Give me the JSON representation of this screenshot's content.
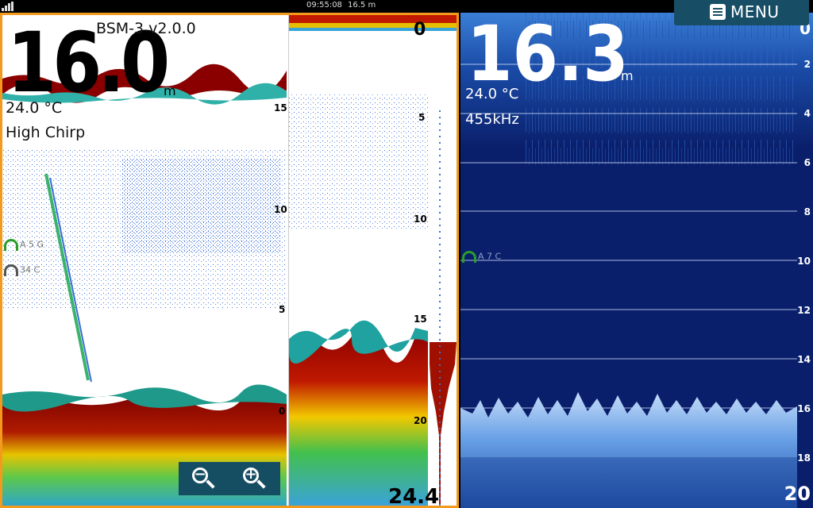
{
  "status": {
    "time": "09:55:08",
    "depth_readout": "16.5 m"
  },
  "menu": {
    "label": "MENU",
    "icon": "menu-icon"
  },
  "left": {
    "device": "BSM-3 v2.0.0",
    "depth": "16.0",
    "depth_unit": "m",
    "temperature": "24.0 °C",
    "mode": "High Chirp",
    "scale_main": [
      "15",
      "10",
      "5",
      "0"
    ],
    "scale_zoom": [
      "0",
      "5",
      "10",
      "15",
      "20"
    ],
    "bottom_depth": "24.4",
    "gauges": [
      {
        "label": "A 5 G"
      },
      {
        "label": "34 C"
      }
    ],
    "zoom_out_icon": "zoom-out-icon",
    "zoom_in_icon": "zoom-in-icon",
    "zoom_out_symbol": "−",
    "zoom_in_symbol": "+"
  },
  "right": {
    "depth": "16.3",
    "depth_unit": "m",
    "temperature": "24.0 °C",
    "frequency": "455kHz",
    "scale": [
      "0",
      "2",
      "4",
      "6",
      "8",
      "10",
      "12",
      "14",
      "16",
      "18"
    ],
    "bottom_depth": "20",
    "gauge": {
      "label": "A 7 C"
    }
  },
  "colors": {
    "frame": "#f39a1e",
    "downscan_bg": "#0a1f6b",
    "button": "#174e66"
  }
}
